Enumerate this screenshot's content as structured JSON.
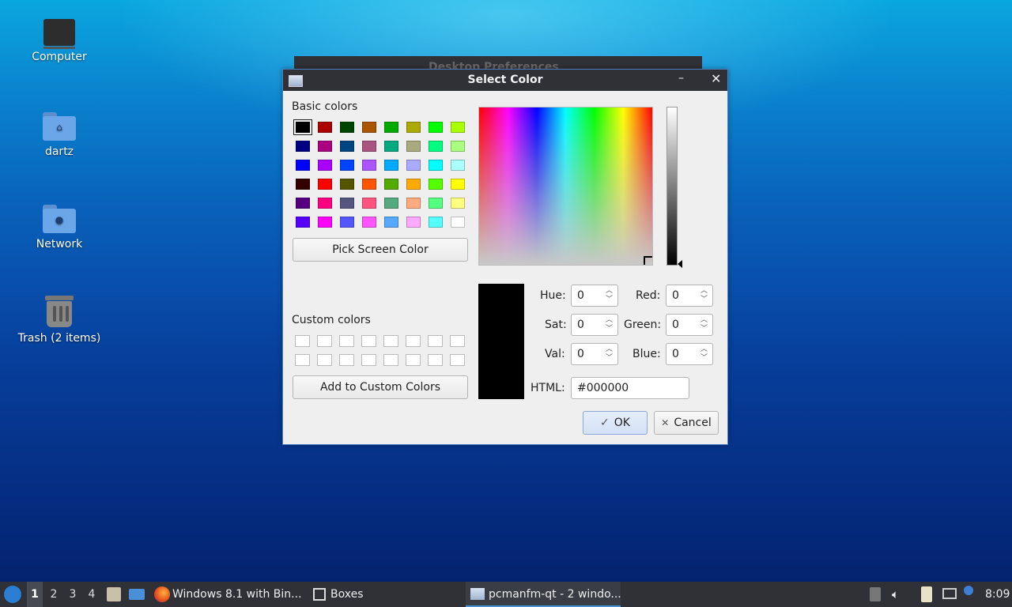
{
  "desktop": {
    "icons": [
      {
        "label": "Computer"
      },
      {
        "label": "dartz"
      },
      {
        "label": "Network"
      },
      {
        "label": "Trash (2 items)"
      }
    ]
  },
  "background_window": {
    "title": "Desktop Preferences"
  },
  "dialog": {
    "title": "Select Color",
    "minimize_glyph": "–",
    "close_glyph": "✕",
    "basic_colors_label": "Basic colors",
    "basic_colors": [
      [
        "#000000",
        "#aa0000",
        "#004400",
        "#aa5500",
        "#00aa00",
        "#aaaa00",
        "#00ff00",
        "#aaff00"
      ],
      [
        "#000080",
        "#aa0080",
        "#004480",
        "#aa5580",
        "#00aa80",
        "#aaaa80",
        "#00ff80",
        "#aaff80"
      ],
      [
        "#0000ff",
        "#aa00ff",
        "#0044ff",
        "#aa55ff",
        "#00aaff",
        "#aaaaff",
        "#00ffff",
        "#aaffff"
      ],
      [
        "#330000",
        "#ff0000",
        "#555500",
        "#ff5500",
        "#55aa00",
        "#ffaa00",
        "#55ff00",
        "#ffff00"
      ],
      [
        "#550080",
        "#ff0080",
        "#555580",
        "#ff5580",
        "#55aa80",
        "#ffaa80",
        "#55ff80",
        "#ffff80"
      ],
      [
        "#5500ff",
        "#ff00ff",
        "#5555ff",
        "#ff55ff",
        "#55aaff",
        "#ffaaff",
        "#55ffff",
        "#ffffff"
      ]
    ],
    "pick_screen_color": "Pick Screen Color",
    "custom_colors_label": "Custom colors",
    "add_to_custom": "Add to Custom Colors",
    "hue_label": "Hue:",
    "hue": "0",
    "sat_label": "Sat:",
    "sat": "0",
    "val_label": "Val:",
    "val": "0",
    "red_label": "Red:",
    "red": "0",
    "green_label": "Green:",
    "green": "0",
    "blue_label": "Blue:",
    "blue": "0",
    "html_label": "HTML:",
    "html_value": "#000000",
    "preview_color": "#000000",
    "ok_label": "OK",
    "ok_glyph": "✓",
    "cancel_label": "Cancel",
    "cancel_glyph": "✕"
  },
  "taskbar": {
    "workspaces": [
      "1",
      "2",
      "3",
      "4"
    ],
    "active_workspace": "1",
    "tasks": [
      {
        "label": "Windows 8.1 with Bin..."
      },
      {
        "label": "Boxes"
      },
      {
        "label": "pcmanfm-qt - 2 windo..."
      }
    ],
    "clock": "8:09"
  }
}
